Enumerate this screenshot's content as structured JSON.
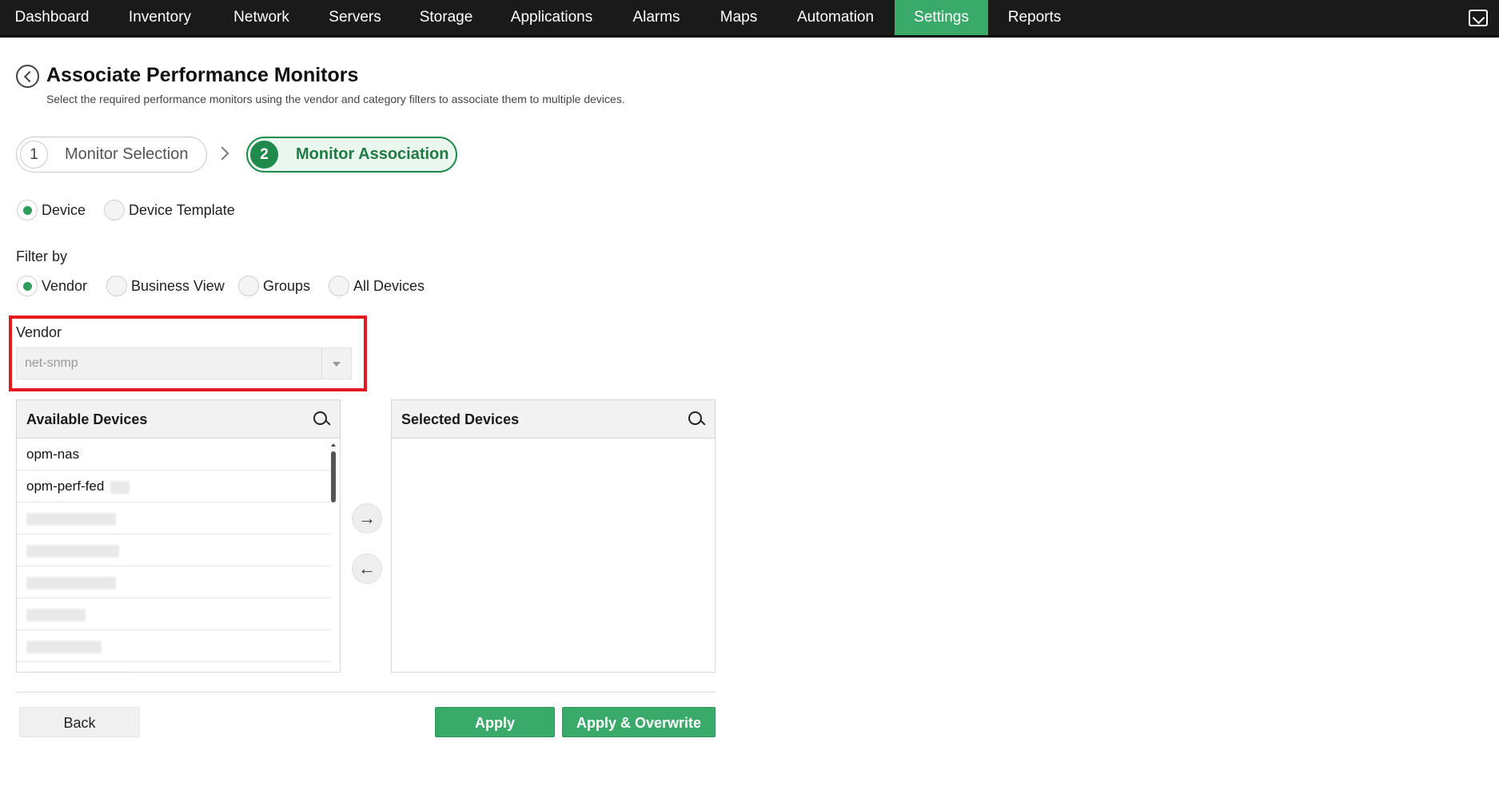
{
  "nav": {
    "items": [
      {
        "label": "Dashboard",
        "active": false
      },
      {
        "label": "Inventory",
        "active": false
      },
      {
        "label": "Network",
        "active": false
      },
      {
        "label": "Servers",
        "active": false
      },
      {
        "label": "Storage",
        "active": false
      },
      {
        "label": "Applications",
        "active": false
      },
      {
        "label": "Alarms",
        "active": false
      },
      {
        "label": "Maps",
        "active": false
      },
      {
        "label": "Automation",
        "active": false
      },
      {
        "label": "Settings",
        "active": true
      },
      {
        "label": "Reports",
        "active": false
      }
    ],
    "active_color": "#3aaa6b"
  },
  "header": {
    "title": "Associate Performance Monitors",
    "subtitle": "Select the required performance monitors using the vendor and category filters to associate them to multiple devices."
  },
  "steps": [
    {
      "number": "1",
      "label": "Monitor Selection",
      "active": false
    },
    {
      "number": "2",
      "label": "Monitor Association",
      "active": true
    }
  ],
  "association_type": {
    "options": [
      "Device",
      "Device Template"
    ],
    "selected": "Device"
  },
  "filter": {
    "label": "Filter by",
    "options": [
      "Vendor",
      "Business View",
      "Groups",
      "All Devices"
    ],
    "selected": "Vendor"
  },
  "vendor": {
    "label": "Vendor",
    "value": "net-snmp",
    "highlight_color": "#e3191f"
  },
  "available_devices": {
    "title": "Available Devices",
    "items": [
      "opm-nas",
      "opm-perf-fed"
    ]
  },
  "selected_devices": {
    "title": "Selected Devices",
    "items": []
  },
  "move": {
    "right_icon": "arrow-right-icon",
    "left_icon": "arrow-left-icon"
  },
  "footer": {
    "back_label": "Back",
    "apply_label": "Apply",
    "apply_overwrite_label": "Apply & Overwrite"
  }
}
